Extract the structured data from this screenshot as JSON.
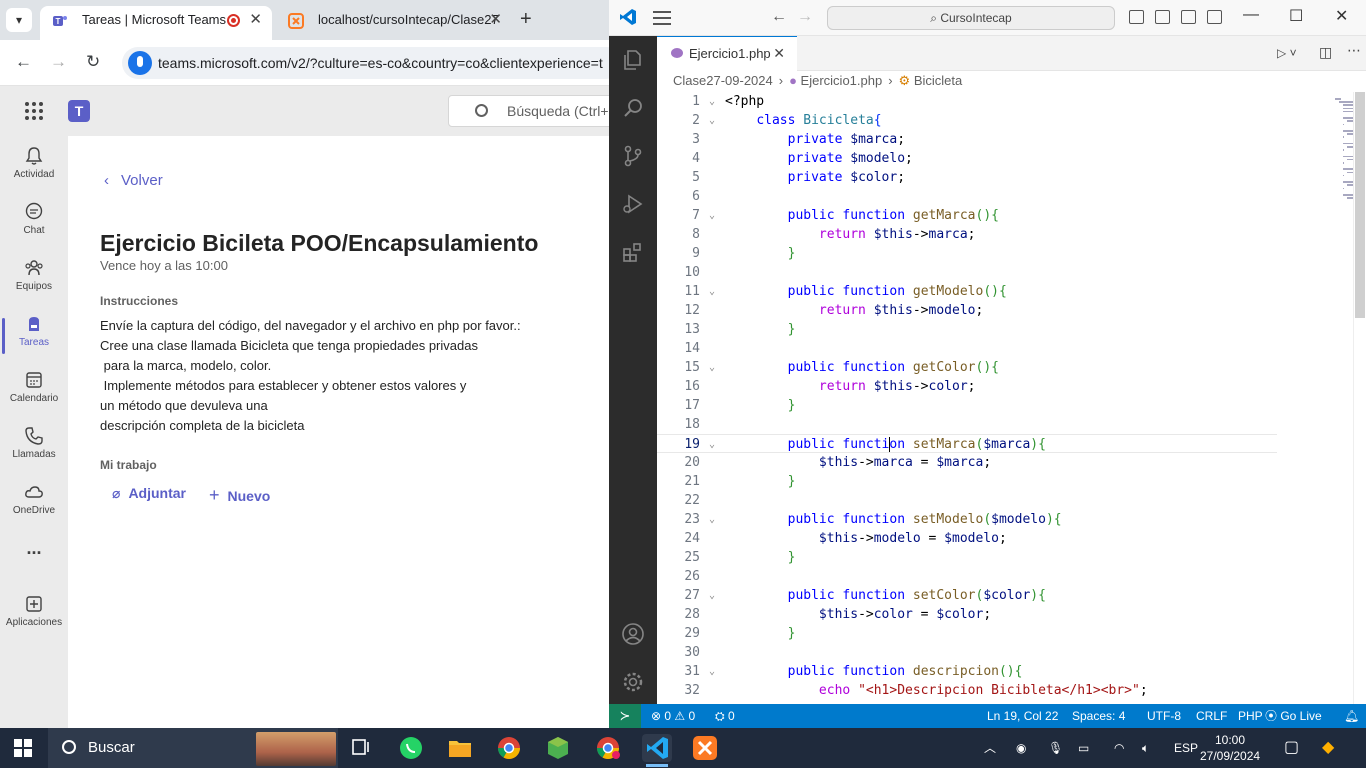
{
  "browser": {
    "tabs": [
      {
        "title": "Tareas | Microsoft Teams"
      },
      {
        "title": "localhost/cursoIntecap/Clase27"
      }
    ],
    "url": "teams.microsoft.com/v2/?culture=es-co&country=co&clientexperience=t"
  },
  "teams": {
    "search_placeholder": "Búsqueda (Ctrl+",
    "rail": [
      {
        "label": "Actividad"
      },
      {
        "label": "Chat"
      },
      {
        "label": "Equipos"
      },
      {
        "label": "Tareas"
      },
      {
        "label": "Calendario"
      },
      {
        "label": "Llamadas"
      },
      {
        "label": "OneDrive"
      },
      {
        "label": "..."
      },
      {
        "label": "Aplicaciones"
      }
    ],
    "back_label": "Volver",
    "assignment_title": "Ejercicio Bicileta POO/Encapsulamiento",
    "due": "Vence hoy a las 10:00",
    "instructions_header": "Instrucciones",
    "instructions": [
      "Envíe la captura del código, del navegador y el archivo en php por favor.:",
      "Cree una clase llamada Bicicleta que tenga propiedades privadas",
      " para la marca, modelo, color.",
      " Implemente métodos para establecer y obtener estos valores y",
      "un método que devuleva una",
      "descripción completa de la bicicleta"
    ],
    "my_work_header": "Mi trabajo",
    "attach_label": "Adjuntar",
    "new_label": "Nuevo"
  },
  "vscode": {
    "command_center": "CursoIntecap",
    "tab_label": "Ejercicio1.php",
    "breadcrumbs": [
      "Clase27-09-2024",
      "Ejercicio1.php",
      "Bicicleta"
    ],
    "status": {
      "errors": "0",
      "warnings": "0",
      "ports": "0",
      "position": "Ln 19, Col 22",
      "spaces": "Spaces: 4",
      "encoding": "UTF-8",
      "eol": "CRLF",
      "language": "PHP",
      "golive": "Go Live"
    }
  },
  "taskbar": {
    "search_label": "Buscar",
    "language": "ESP",
    "time": "10:00",
    "date": "27/09/2024"
  },
  "code_lines": [
    [
      [
        "",
        "<?php"
      ]
    ],
    [
      [
        "",
        "    "
      ],
      [
        "kw",
        "class"
      ],
      [
        "",
        " "
      ],
      [
        "cls",
        "Bicicleta"
      ],
      [
        "br1",
        "{"
      ]
    ],
    [
      [
        "",
        "        "
      ],
      [
        "kw",
        "private"
      ],
      [
        "",
        " "
      ],
      [
        "var",
        "$marca"
      ],
      [
        "",
        ";"
      ]
    ],
    [
      [
        "",
        "        "
      ],
      [
        "kw",
        "private"
      ],
      [
        "",
        " "
      ],
      [
        "var",
        "$modelo"
      ],
      [
        "",
        ";"
      ]
    ],
    [
      [
        "",
        "        "
      ],
      [
        "kw",
        "private"
      ],
      [
        "",
        " "
      ],
      [
        "var",
        "$color"
      ],
      [
        "",
        ";"
      ]
    ],
    [
      [
        "",
        ""
      ]
    ],
    [
      [
        "",
        "        "
      ],
      [
        "kw",
        "public"
      ],
      [
        "",
        " "
      ],
      [
        "kw",
        "function"
      ],
      [
        "",
        " "
      ],
      [
        "fn",
        "getMarca"
      ],
      [
        "br2",
        "()"
      ],
      [
        "br2",
        "{"
      ]
    ],
    [
      [
        "",
        "            "
      ],
      [
        "kw2",
        "return"
      ],
      [
        "",
        " "
      ],
      [
        "var",
        "$this"
      ],
      [
        "",
        "->"
      ],
      [
        "var",
        "marca"
      ],
      [
        "",
        ";"
      ]
    ],
    [
      [
        "",
        "        "
      ],
      [
        "br2",
        "}"
      ]
    ],
    [
      [
        "",
        ""
      ]
    ],
    [
      [
        "",
        "        "
      ],
      [
        "kw",
        "public"
      ],
      [
        "",
        " "
      ],
      [
        "kw",
        "function"
      ],
      [
        "",
        " "
      ],
      [
        "fn",
        "getModelo"
      ],
      [
        "br2",
        "()"
      ],
      [
        "br2",
        "{"
      ]
    ],
    [
      [
        "",
        "            "
      ],
      [
        "kw2",
        "return"
      ],
      [
        "",
        " "
      ],
      [
        "var",
        "$this"
      ],
      [
        "",
        "->"
      ],
      [
        "var",
        "modelo"
      ],
      [
        "",
        ";"
      ]
    ],
    [
      [
        "",
        "        "
      ],
      [
        "br2",
        "}"
      ]
    ],
    [
      [
        "",
        ""
      ]
    ],
    [
      [
        "",
        "        "
      ],
      [
        "kw",
        "public"
      ],
      [
        "",
        " "
      ],
      [
        "kw",
        "function"
      ],
      [
        "",
        " "
      ],
      [
        "fn",
        "getColor"
      ],
      [
        "br2",
        "()"
      ],
      [
        "br2",
        "{"
      ]
    ],
    [
      [
        "",
        "            "
      ],
      [
        "kw2",
        "return"
      ],
      [
        "",
        " "
      ],
      [
        "var",
        "$this"
      ],
      [
        "",
        "->"
      ],
      [
        "var",
        "color"
      ],
      [
        "",
        ";"
      ]
    ],
    [
      [
        "",
        "        "
      ],
      [
        "br2",
        "}"
      ]
    ],
    [
      [
        "",
        ""
      ]
    ],
    [
      [
        "",
        "        "
      ],
      [
        "kw",
        "public"
      ],
      [
        "",
        " "
      ],
      [
        "kw",
        "functi"
      ],
      [
        "caret",
        ""
      ],
      [
        "kw",
        "on"
      ],
      [
        "",
        " "
      ],
      [
        "fn",
        "setMarca"
      ],
      [
        "br2",
        "("
      ],
      [
        "var",
        "$marca"
      ],
      [
        "br2",
        ")"
      ],
      [
        "br2",
        "{"
      ]
    ],
    [
      [
        "",
        "            "
      ],
      [
        "var",
        "$this"
      ],
      [
        "",
        "->"
      ],
      [
        "var",
        "marca"
      ],
      [
        "",
        " = "
      ],
      [
        "var",
        "$marca"
      ],
      [
        "",
        ";"
      ]
    ],
    [
      [
        "",
        "        "
      ],
      [
        "br2",
        "}"
      ]
    ],
    [
      [
        "",
        ""
      ]
    ],
    [
      [
        "",
        "        "
      ],
      [
        "kw",
        "public"
      ],
      [
        "",
        " "
      ],
      [
        "kw",
        "function"
      ],
      [
        "",
        " "
      ],
      [
        "fn",
        "setModelo"
      ],
      [
        "br2",
        "("
      ],
      [
        "var",
        "$modelo"
      ],
      [
        "br2",
        ")"
      ],
      [
        "br2",
        "{"
      ]
    ],
    [
      [
        "",
        "            "
      ],
      [
        "var",
        "$this"
      ],
      [
        "",
        "->"
      ],
      [
        "var",
        "modelo"
      ],
      [
        "",
        " = "
      ],
      [
        "var",
        "$modelo"
      ],
      [
        "",
        ";"
      ]
    ],
    [
      [
        "",
        "        "
      ],
      [
        "br2",
        "}"
      ]
    ],
    [
      [
        "",
        ""
      ]
    ],
    [
      [
        "",
        "        "
      ],
      [
        "kw",
        "public"
      ],
      [
        "",
        " "
      ],
      [
        "kw",
        "function"
      ],
      [
        "",
        " "
      ],
      [
        "fn",
        "setColor"
      ],
      [
        "br2",
        "("
      ],
      [
        "var",
        "$color"
      ],
      [
        "br2",
        ")"
      ],
      [
        "br2",
        "{"
      ]
    ],
    [
      [
        "",
        "            "
      ],
      [
        "var",
        "$this"
      ],
      [
        "",
        "->"
      ],
      [
        "var",
        "color"
      ],
      [
        "",
        " = "
      ],
      [
        "var",
        "$color"
      ],
      [
        "",
        ";"
      ]
    ],
    [
      [
        "",
        "        "
      ],
      [
        "br2",
        "}"
      ]
    ],
    [
      [
        "",
        ""
      ]
    ],
    [
      [
        "",
        "        "
      ],
      [
        "kw",
        "public"
      ],
      [
        "",
        " "
      ],
      [
        "kw",
        "function"
      ],
      [
        "",
        " "
      ],
      [
        "fn",
        "descripcion"
      ],
      [
        "br2",
        "()"
      ],
      [
        "br2",
        "{"
      ]
    ],
    [
      [
        "",
        "            "
      ],
      [
        "kw2",
        "echo"
      ],
      [
        "",
        " "
      ],
      [
        "str",
        "\"<h1>Descripcion Bicibleta</h1><br>\""
      ],
      [
        "",
        ";"
      ]
    ]
  ],
  "fold_lines": [
    1,
    2,
    7,
    11,
    15,
    19,
    23,
    27,
    31
  ],
  "current_line": 19,
  "colors": {
    "teams_accent": "#5b5fc7",
    "vscode_status": "#007acc",
    "activity_bar": "#2c2c2c",
    "taskbar": "#1f2a3c"
  }
}
